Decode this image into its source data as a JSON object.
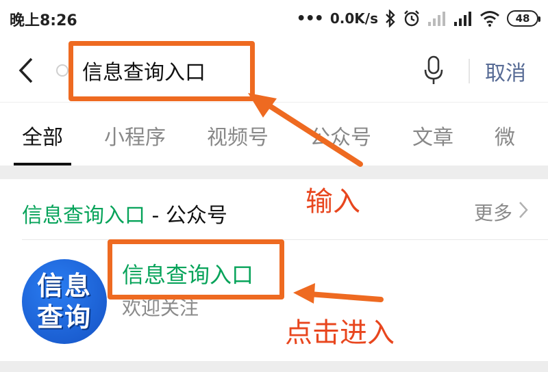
{
  "status_bar": {
    "time": "晚上8:26",
    "network_speed": "0.0K/s",
    "battery": "48"
  },
  "search": {
    "query": "信息查询入口",
    "cancel_label": "取消"
  },
  "tabs": [
    {
      "label": "全部",
      "active": true
    },
    {
      "label": "小程序"
    },
    {
      "label": "视频号"
    },
    {
      "label": "公众号"
    },
    {
      "label": "文章"
    },
    {
      "label": "微"
    }
  ],
  "section": {
    "title_query": "信息查询入口",
    "title_suffix": " - 公众号",
    "more_label": "更多"
  },
  "result": {
    "avatar_line1": "信息",
    "avatar_line2": "查询",
    "name": "信息查询入口",
    "description": "欢迎关注"
  },
  "annotations": {
    "input_label": "输入",
    "click_label": "点击进入",
    "color": "#ee6a21"
  },
  "colors": {
    "accent_green": "#07a35a",
    "link_blue": "#576b95"
  }
}
